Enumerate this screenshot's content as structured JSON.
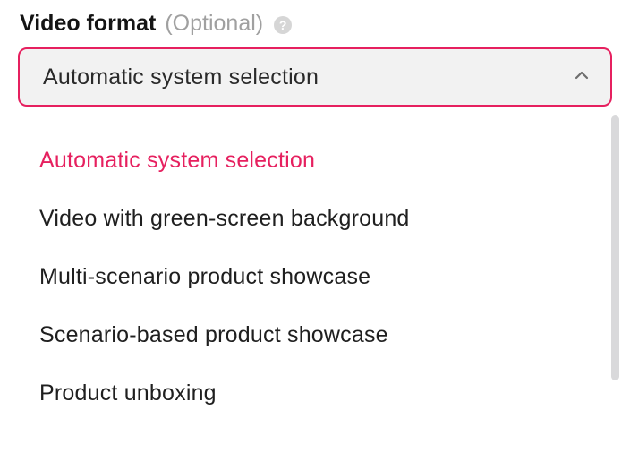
{
  "field": {
    "label": "Video format",
    "optional": "(Optional)"
  },
  "select": {
    "value": "Automatic system selection"
  },
  "options": {
    "opt0": "Automatic system selection",
    "opt1": "Video with green-screen background",
    "opt2": "Multi-scenario product showcase",
    "opt3": "Scenario-based product showcase",
    "opt4": "Product unboxing"
  },
  "colors": {
    "accent": "#e6205f"
  }
}
